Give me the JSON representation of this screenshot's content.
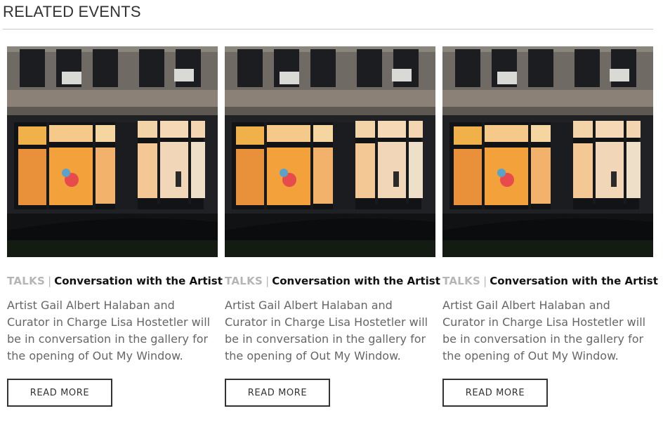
{
  "section": {
    "title": "RELATED EVENTS"
  },
  "colors": {
    "category": "#b5b5b5",
    "title": "#111111",
    "description": "#666666",
    "button_border": "#333333",
    "rule": "#c8c8c8"
  },
  "events": [
    {
      "image_alt": "building-window-photo",
      "category": "TALKS",
      "separator": "|",
      "title": "Conversation with the Artist",
      "description": "Artist Gail Albert Halaban and Curator in Charge Lisa Hostetler will be in conversation in the gallery for the opening of Out My Window.",
      "button_label": "READ MORE"
    },
    {
      "image_alt": "building-window-photo",
      "category": "TALKS",
      "separator": "|",
      "title": "Conversation with the Artist",
      "description": "Artist Gail Albert Halaban and Curator in Charge Lisa Hostetler will be in conversation in the gallery for the opening of Out My Window.",
      "button_label": "READ MORE"
    },
    {
      "image_alt": "building-window-photo",
      "category": "TALKS",
      "separator": "|",
      "title": "Conversation with the Artist",
      "description": "Artist Gail Albert Halaban and Curator in Charge Lisa Hostetler will be in conversation in the gallery for the opening of Out My Window.",
      "button_label": "READ MORE"
    }
  ]
}
